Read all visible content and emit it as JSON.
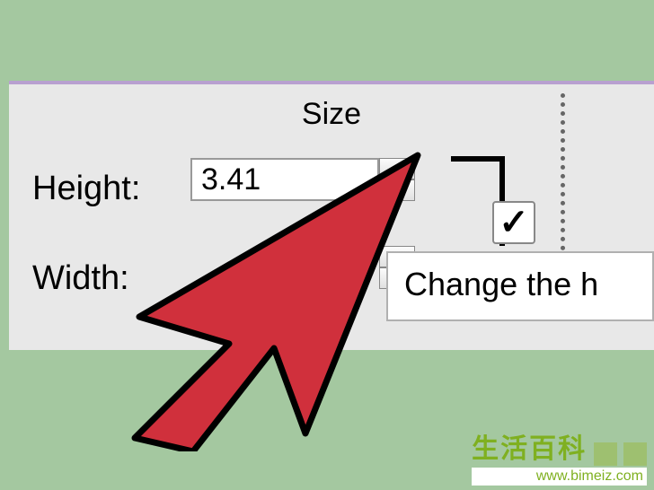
{
  "panel": {
    "title": "Size",
    "height_label": "Height:",
    "width_label": "Width:",
    "height_value": "3.41"
  },
  "tooltip": {
    "text": "Change the h"
  },
  "watermark": {
    "chinese": "生活百科",
    "url": "www.bimeiz.com"
  }
}
